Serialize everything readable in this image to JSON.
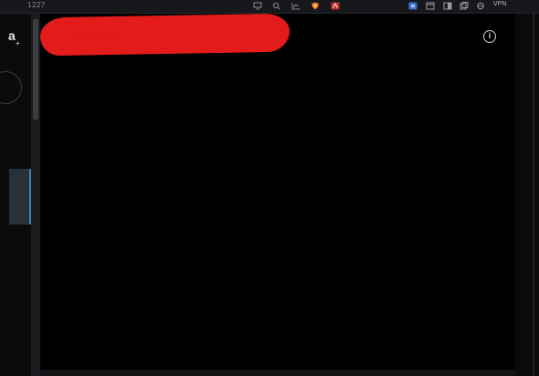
{
  "status_bar": {
    "clock": "1227",
    "icons": [
      "monitor-icon",
      "search-icon",
      "chart-icon",
      "shield-app-icon",
      "red-app-icon",
      "blue-app-icon",
      "window-icon",
      "sidebar-toggle-icon",
      "layers-icon",
      "network-icon"
    ],
    "vpn_label": "VPN"
  },
  "sidebar": {
    "logo": "a",
    "badge": "+"
  },
  "main": {
    "redacted_text": "— — — — — —",
    "info_symbol": "i"
  },
  "colors": {
    "background": "#000000",
    "redaction": "#e31b1b",
    "accent": "#3d7fb8"
  }
}
